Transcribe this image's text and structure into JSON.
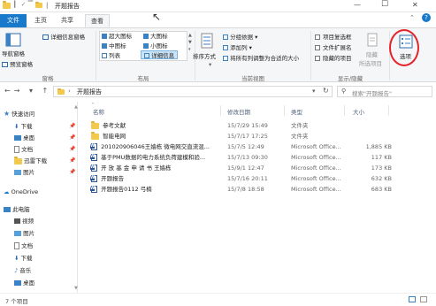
{
  "window": {
    "title": "开题报告",
    "minimize": "—",
    "maximize": "☐",
    "close": "✕",
    "help": "?"
  },
  "ribbon_tabs": {
    "file": "文件",
    "home": "主页",
    "share": "共享",
    "view": "查看"
  },
  "ribbon": {
    "panes": {
      "group_label": "窗格",
      "nav_pane": "导航窗格",
      "preview_pane": "预览窗格",
      "details_pane": "详细信息窗格"
    },
    "layout": {
      "group_label": "布局",
      "items": [
        "超大图标",
        "大图标",
        "中图标",
        "小图标",
        "列表",
        "详细信息"
      ]
    },
    "current_view": {
      "group_label": "当前视图",
      "sort_by": "排序方式",
      "group_by": "分组依据",
      "add_columns": "添加列",
      "fit_columns": "将所有列调整为合适的大小"
    },
    "show_hide": {
      "group_label": "显示/隐藏",
      "item_checkboxes": "项目复选框",
      "file_extensions": "文件扩展名",
      "hidden_items": "隐藏的项目",
      "hide_selected_1": "隐藏",
      "hide_selected_2": "所选项目"
    },
    "options": "选项"
  },
  "address": {
    "path": "开题报告",
    "search_placeholder": "搜索\"开题报告\""
  },
  "nav": {
    "quick_access": "快速访问",
    "quick_items": [
      "下载",
      "桌面",
      "文档",
      "迅雷下载",
      "图片"
    ],
    "onedrive": "OneDrive",
    "this_pc": "此电脑",
    "pc_items": [
      "视频",
      "图片",
      "文档",
      "下载",
      "音乐",
      "桌面"
    ]
  },
  "columns": {
    "name": "名称",
    "modified": "修改日期",
    "type": "类型",
    "size": "大小"
  },
  "files": [
    {
      "name": "参考文献",
      "date": "15/7/29 15:49",
      "type": "文件夹",
      "size": "",
      "kind": "folder"
    },
    {
      "name": "智能电网",
      "date": "15/7/17 17:25",
      "type": "文件夹",
      "size": "",
      "kind": "folder"
    },
    {
      "name": "201020906046王嫱栋 微电网交直流混...",
      "date": "15/7/5 12:49",
      "type": "Microsoft Office...",
      "size": "1,885 KB",
      "kind": "word"
    },
    {
      "name": "基于PMU数据的电力系统负荷建模和验...",
      "date": "15/7/13 09:30",
      "type": "Microsoft Office...",
      "size": "117 KB",
      "kind": "word"
    },
    {
      "name": "开 放 基 金 申 请 书  王嫱栋",
      "date": "15/9/1 12:47",
      "type": "Microsoft Office...",
      "size": "173 KB",
      "kind": "word"
    },
    {
      "name": "开题报告",
      "date": "15/7/16 20:11",
      "type": "Microsoft Office...",
      "size": "632 KB",
      "kind": "word"
    },
    {
      "name": "开题报告0112 弓楠",
      "date": "15/7/8 18:58",
      "type": "Microsoft Office...",
      "size": "683 KB",
      "kind": "word"
    }
  ],
  "status": {
    "count": "7 个项目"
  },
  "colors": {
    "accent": "#1979ca",
    "highlight_circle": "#e3242b"
  }
}
